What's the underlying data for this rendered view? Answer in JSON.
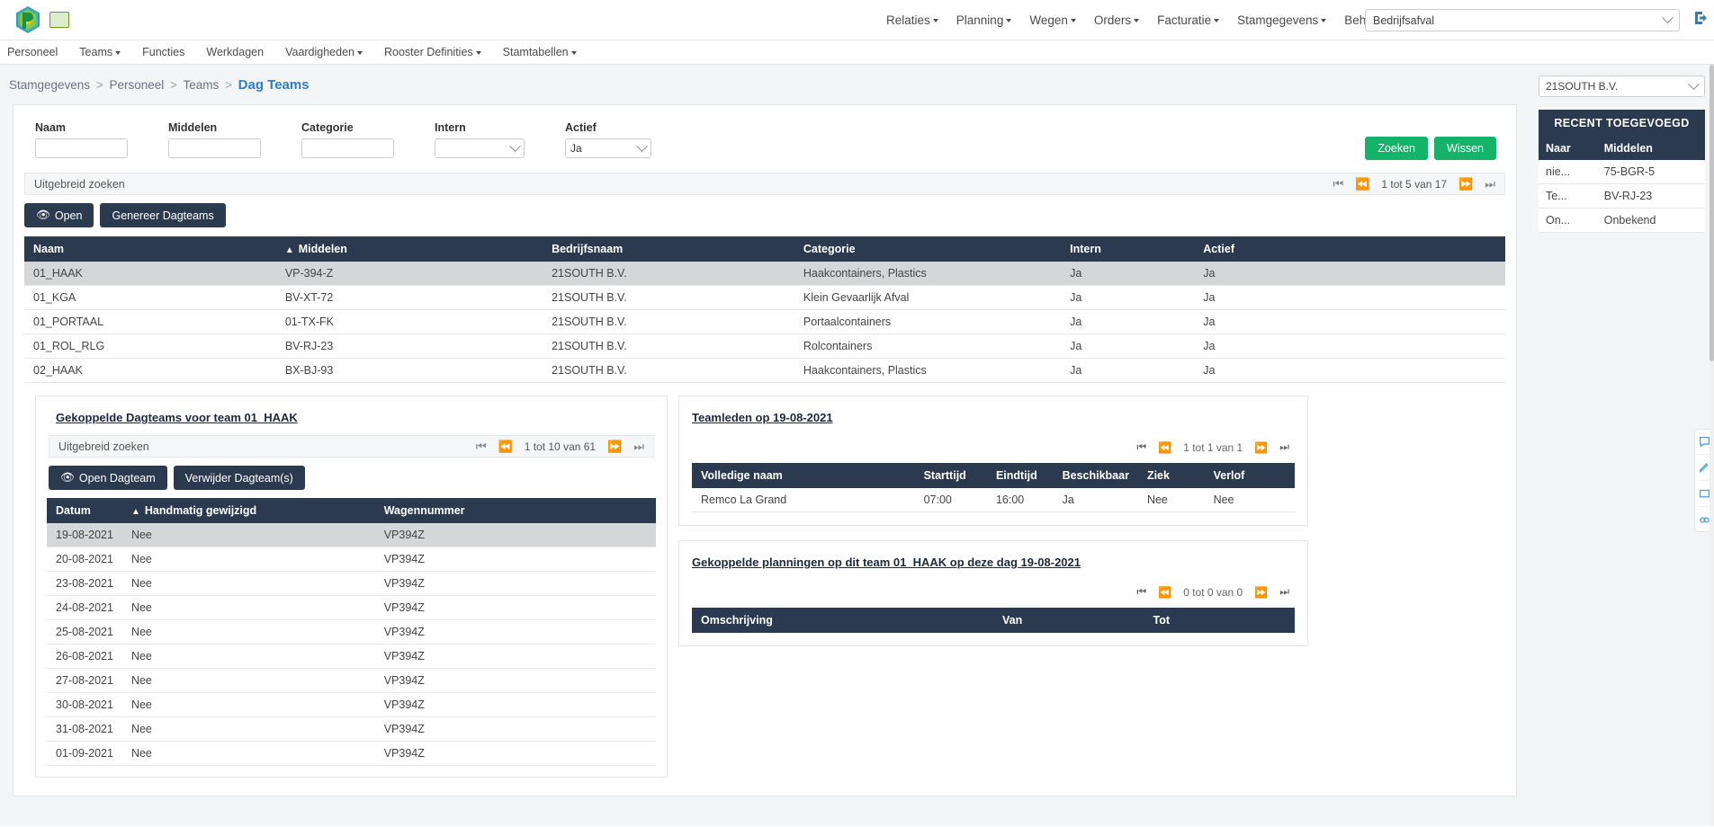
{
  "topbar": {
    "logo_name": "app-logo",
    "nav": [
      {
        "label": "Relaties",
        "has_caret": true
      },
      {
        "label": "Planning",
        "has_caret": true
      },
      {
        "label": "Wegen",
        "has_caret": true
      },
      {
        "label": "Orders",
        "has_caret": true
      },
      {
        "label": "Facturatie",
        "has_caret": true
      },
      {
        "label": "Stamgegevens",
        "has_caret": true
      },
      {
        "label": "Beheer",
        "has_caret": true
      }
    ],
    "company_select": "Bedrijfsafval",
    "logout_icon": "logout-icon"
  },
  "subnav": [
    {
      "label": "Personeel",
      "has_caret": false
    },
    {
      "label": "Teams",
      "has_caret": true
    },
    {
      "label": "Functies",
      "has_caret": false
    },
    {
      "label": "Werkdagen",
      "has_caret": false
    },
    {
      "label": "Vaardigheden",
      "has_caret": true
    },
    {
      "label": "Rooster Definities",
      "has_caret": true
    },
    {
      "label": "Stamtabellen",
      "has_caret": true
    }
  ],
  "breadcrumb": {
    "crumb1": "Stamgegevens",
    "crumb2": "Personeel",
    "crumb3": "Teams",
    "current": "Dag Teams",
    "sep": ">"
  },
  "filters": {
    "naam_label": "Naam",
    "naam_value": "",
    "middelen_label": "Middelen",
    "middelen_value": "",
    "categorie_label": "Categorie",
    "categorie_value": "",
    "intern_label": "Intern",
    "intern_value": "",
    "actief_label": "Actief",
    "actief_value": "Ja",
    "search_button": "Zoeken",
    "clear_button": "Wissen"
  },
  "advanced_search_label": "Uitgebreid zoeken",
  "main_pager": {
    "first": "⏮",
    "prev": "⏪",
    "text": "1 tot 5 van 17",
    "next": "⏩",
    "last": "⏭"
  },
  "toolbar": {
    "open_button": "Open",
    "generate_button": "Genereer Dagteams",
    "eye_icon": "eye-icon"
  },
  "main_table": {
    "columns": [
      "Naam",
      "Middelen",
      "Bedrijfsnaam",
      "Categorie",
      "Intern",
      "Actief"
    ],
    "sort_column_index": 1,
    "sort_direction": "asc",
    "rows": [
      {
        "naam": "01_HAAK",
        "middelen": "VP-394-Z",
        "bedrijfsnaam": "21SOUTH B.V.",
        "categorie": "Haakcontainers, Plastics",
        "intern": "Ja",
        "actief": "Ja",
        "selected": true
      },
      {
        "naam": "01_KGA",
        "middelen": "BV-XT-72",
        "bedrijfsnaam": "21SOUTH B.V.",
        "categorie": "Klein Gevaarlijk Afval",
        "intern": "Ja",
        "actief": "Ja",
        "selected": false
      },
      {
        "naam": "01_PORTAAL",
        "middelen": "01-TX-FK",
        "bedrijfsnaam": "21SOUTH B.V.",
        "categorie": "Portaalcontainers",
        "intern": "Ja",
        "actief": "Ja",
        "selected": false
      },
      {
        "naam": "01_ROL_RLG",
        "middelen": "BV-RJ-23",
        "bedrijfsnaam": "21SOUTH B.V.",
        "categorie": "Rolcontainers",
        "intern": "Ja",
        "actief": "Ja",
        "selected": false
      },
      {
        "naam": "02_HAAK",
        "middelen": "BX-BJ-93",
        "bedrijfsnaam": "21SOUTH B.V.",
        "categorie": "Haakcontainers, Plastics",
        "intern": "Ja",
        "actief": "Ja",
        "selected": false
      }
    ]
  },
  "dagteams_panel": {
    "title": "Gekoppelde Dagteams voor team 01_HAAK",
    "advanced_search_label": "Uitgebreid zoeken",
    "pager": {
      "text": "1 tot 10 van 61"
    },
    "open_button": "Open Dagteam",
    "delete_button": "Verwijder Dagteam(s)",
    "columns": [
      "Datum",
      "Handmatig gewijzigd",
      "Wagennummer"
    ],
    "sort_column_index": 0,
    "rows": [
      {
        "datum": "19-08-2021",
        "handmatig": "Nee",
        "wagen": "VP394Z",
        "selected": true
      },
      {
        "datum": "20-08-2021",
        "handmatig": "Nee",
        "wagen": "VP394Z",
        "selected": false
      },
      {
        "datum": "23-08-2021",
        "handmatig": "Nee",
        "wagen": "VP394Z",
        "selected": false
      },
      {
        "datum": "24-08-2021",
        "handmatig": "Nee",
        "wagen": "VP394Z",
        "selected": false
      },
      {
        "datum": "25-08-2021",
        "handmatig": "Nee",
        "wagen": "VP394Z",
        "selected": false
      },
      {
        "datum": "26-08-2021",
        "handmatig": "Nee",
        "wagen": "VP394Z",
        "selected": false
      },
      {
        "datum": "27-08-2021",
        "handmatig": "Nee",
        "wagen": "VP394Z",
        "selected": false
      },
      {
        "datum": "30-08-2021",
        "handmatig": "Nee",
        "wagen": "VP394Z",
        "selected": false
      },
      {
        "datum": "31-08-2021",
        "handmatig": "Nee",
        "wagen": "VP394Z",
        "selected": false
      },
      {
        "datum": "01-09-2021",
        "handmatig": "Nee",
        "wagen": "VP394Z",
        "selected": false
      }
    ]
  },
  "teamleden_panel": {
    "title": "Teamleden op 19-08-2021",
    "pager": {
      "text": "1 tot 1 van 1"
    },
    "columns": [
      "Volledige naam",
      "Starttijd",
      "Eindtijd",
      "Beschikbaar",
      "Ziek",
      "Verlof"
    ],
    "rows": [
      {
        "naam": "Remco La Grand",
        "start": "07:00",
        "eind": "16:00",
        "beschikbaar": "Ja",
        "ziek": "Nee",
        "verlof": "Nee"
      }
    ]
  },
  "planningen_panel": {
    "title": "Gekoppelde planningen op dit team 01_HAAK op deze dag 19-08-2021",
    "pager": {
      "text": "0 tot 0 van 0"
    },
    "columns": [
      "Omschrijving",
      "Van",
      "Tot"
    ],
    "rows": []
  },
  "sidebar": {
    "company_select": "21SOUTH B.V.",
    "header": "RECENT TOEGEVOEGD",
    "columns": [
      "Naar",
      "Middelen"
    ],
    "rows": [
      {
        "naar": "nie...",
        "middelen": "75-BGR-5"
      },
      {
        "naar": "Te...",
        "middelen": "BV-RJ-23"
      },
      {
        "naar": "On...",
        "middelen": "Onbekend"
      }
    ]
  },
  "feedback_widget": {
    "icons": [
      "chat-icon",
      "pencil-icon",
      "screen-icon",
      "link-icon"
    ]
  },
  "colors": {
    "header_dark": "#2b3a4f",
    "accent_green": "#15b36a",
    "breadcrumb_link": "#2f7fc1",
    "row_selected": "#d5d6d8"
  }
}
